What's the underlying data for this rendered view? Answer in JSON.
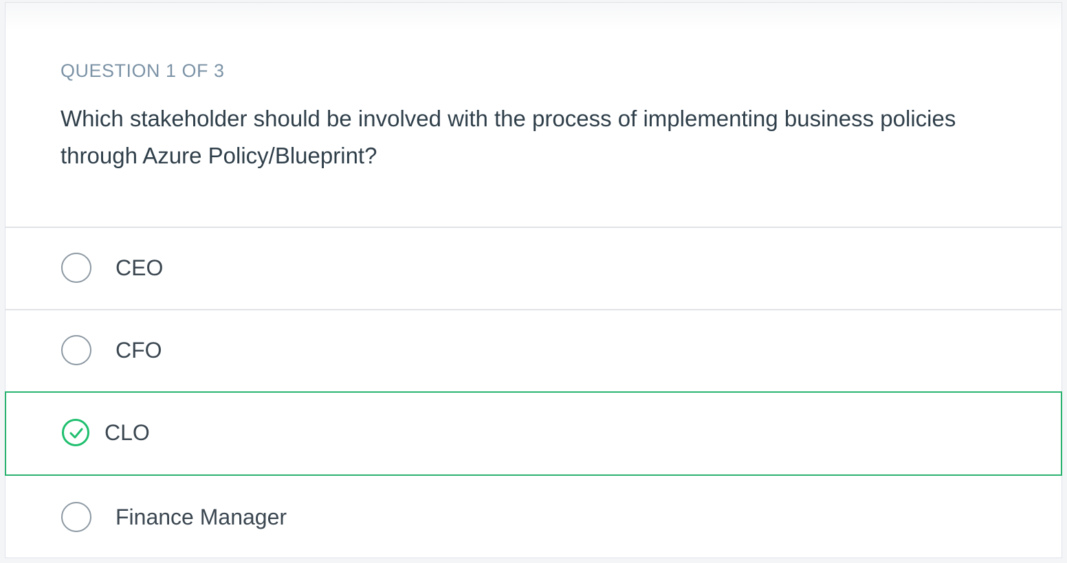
{
  "quiz": {
    "counter": "QUESTION 1 OF 3",
    "question": "Which stakeholder should be involved with the process of implementing business policies through Azure Policy/Blueprint?",
    "options": [
      {
        "label": "CEO",
        "selected": false
      },
      {
        "label": "CFO",
        "selected": false
      },
      {
        "label": "CLO",
        "selected": true
      },
      {
        "label": "Finance Manager",
        "selected": false
      }
    ]
  },
  "colors": {
    "accent_correct": "#29b36f",
    "counter_text": "#7c93a6",
    "question_text": "#2f3f4a",
    "radio_border": "#8c98a2"
  },
  "icons": {
    "selected_indicator": "check-circle-icon",
    "unselected_indicator": "radio-empty-icon"
  }
}
